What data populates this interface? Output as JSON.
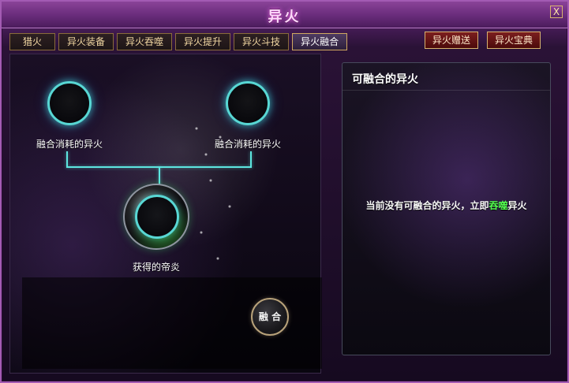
{
  "window": {
    "title": "异火",
    "close_icon": "close-icon",
    "close_glyph": "X"
  },
  "tabs": [
    {
      "label": "猎火",
      "active": false
    },
    {
      "label": "异火装备",
      "active": false
    },
    {
      "label": "异火吞噬",
      "active": false
    },
    {
      "label": "异火提升",
      "active": false
    },
    {
      "label": "异火斗技",
      "active": false
    },
    {
      "label": "异火融合",
      "active": true
    }
  ],
  "actions": {
    "gift_label": "异火赠送",
    "codex_label": "异火宝典"
  },
  "fusion": {
    "slot_left_label": "融合消耗的异火",
    "slot_right_label": "融合消耗的异火",
    "result_label": "获得的帝炎",
    "fuse_button_label": "融 合"
  },
  "right_panel": {
    "title": "可融合的异火",
    "message_prefix": "当前没有可融合的异火，立即",
    "message_link": "吞噬",
    "message_suffix": "异火"
  },
  "colors": {
    "accent_purple": "#a35bb3",
    "glow_cyan": "#58d7d4",
    "link_green": "#53ff4f",
    "button_red": "#7c1f1f"
  }
}
